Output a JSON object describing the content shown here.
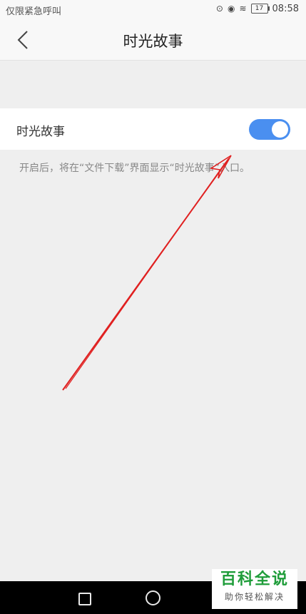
{
  "status_bar": {
    "carrier_text": "仅限紧急呼叫",
    "battery_level": "17",
    "time": "08:58",
    "icons": [
      "signal-icon",
      "eye-icon",
      "wifi-icon",
      "battery-icon"
    ]
  },
  "header": {
    "title": "时光故事",
    "back_icon": "chevron-left-icon"
  },
  "setting": {
    "label": "时光故事",
    "toggle_on": true,
    "description": "开启后，将在“文件下载”界面显示“时光故事”入口。"
  },
  "watermark": {
    "main": "百科全说",
    "sub": "助你轻松解决"
  },
  "colors": {
    "toggle_on": "#4a8ff0",
    "annotation_arrow": "#e02020",
    "watermark_green": "#1f9d3a"
  }
}
